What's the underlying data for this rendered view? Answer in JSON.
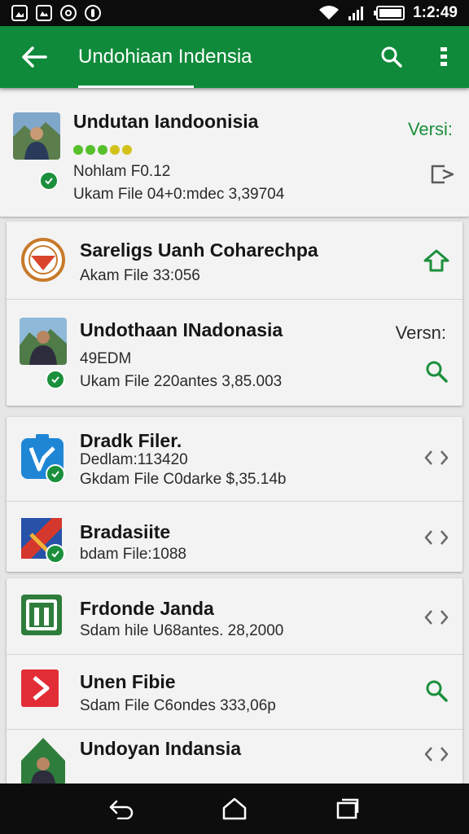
{
  "status_bar": {
    "time": "1:2:49",
    "left_icons": [
      "photo-icon",
      "gallery-icon",
      "sync-icon",
      "alert-icon"
    ],
    "right_icons": [
      "wifi-icon",
      "signal-icon",
      "battery-icon"
    ]
  },
  "app_bar": {
    "title": "Undohiaan Indensia",
    "back_icon": "arrow-left-icon",
    "search_icon": "search-icon",
    "menu_icon": "overflow-menu-icon"
  },
  "items": [
    {
      "title": "Undutan Iandoonisia",
      "line1": "Nohlam F0.12",
      "line2": "Ukam File 04+0:mdec 3,39704",
      "version": "Versi:",
      "action_icon": "open-external-icon",
      "rating_stars": 5
    },
    {
      "title": "Sareligs Uanh Coharechpa",
      "line1": "Akam File 33:056",
      "action_icon": "upload-icon"
    },
    {
      "title": "Undothaan INadonasia",
      "line1": "49EDM",
      "line2": "Ukam File 220antes 3,85.003",
      "version": "Versn:",
      "action_icon": "search-icon"
    },
    {
      "title": "Dradk Filer.",
      "line1": "Dedlam:113420",
      "line2": "Gkdam File C0darke $,35.14b",
      "action_icon": "code-arrows-icon"
    },
    {
      "title": "Bradasiite",
      "line1": "bdam File:1088",
      "action_icon": "code-arrows-icon"
    },
    {
      "title": "Frdonde Janda",
      "line1": "Sdam hile U68antes. 28,2000",
      "action_icon": "code-arrows-icon"
    },
    {
      "title": "Unen Fibie",
      "line1": "Sdam File C6ondes 333,06p",
      "action_icon": "search-icon"
    },
    {
      "title": "Undoyan Indansia",
      "action_icon": "code-arrows-icon"
    }
  ],
  "nav_bar": {
    "icons": [
      "back-icon",
      "home-icon",
      "recents-icon"
    ]
  },
  "colors": {
    "primary": "#0f8a3a",
    "accent_green": "#1b8f3c",
    "background": "#e6e6e6",
    "card": "#f3f3f3"
  }
}
